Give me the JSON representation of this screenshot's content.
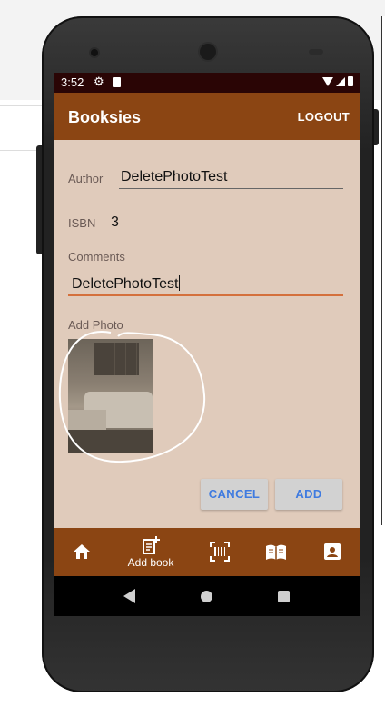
{
  "status_bar": {
    "time": "3:52"
  },
  "app_bar": {
    "title": "Booksies",
    "logout_label": "LOGOUT"
  },
  "form": {
    "author_label": "Author",
    "author_value": "DeletePhotoTest",
    "isbn_label": "ISBN",
    "isbn_value": "3",
    "comments_label": "Comments",
    "comments_value": "DeletePhotoTest",
    "photo_label": "Add Photo"
  },
  "actions": {
    "cancel_label": "CANCEL",
    "add_label": "ADD"
  },
  "bottom_nav": {
    "items": [
      {
        "icon": "home-icon",
        "label": ""
      },
      {
        "icon": "add-book-icon",
        "label": "Add book"
      },
      {
        "icon": "barcode-scan-icon",
        "label": ""
      },
      {
        "icon": "open-book-icon",
        "label": ""
      },
      {
        "icon": "account-icon",
        "label": ""
      }
    ]
  },
  "colors": {
    "primary": "#8b4513",
    "background": "#e0cbbb",
    "status_bar": "#2a0505",
    "accent": "#d4703c",
    "button_text": "#3f7be0"
  }
}
